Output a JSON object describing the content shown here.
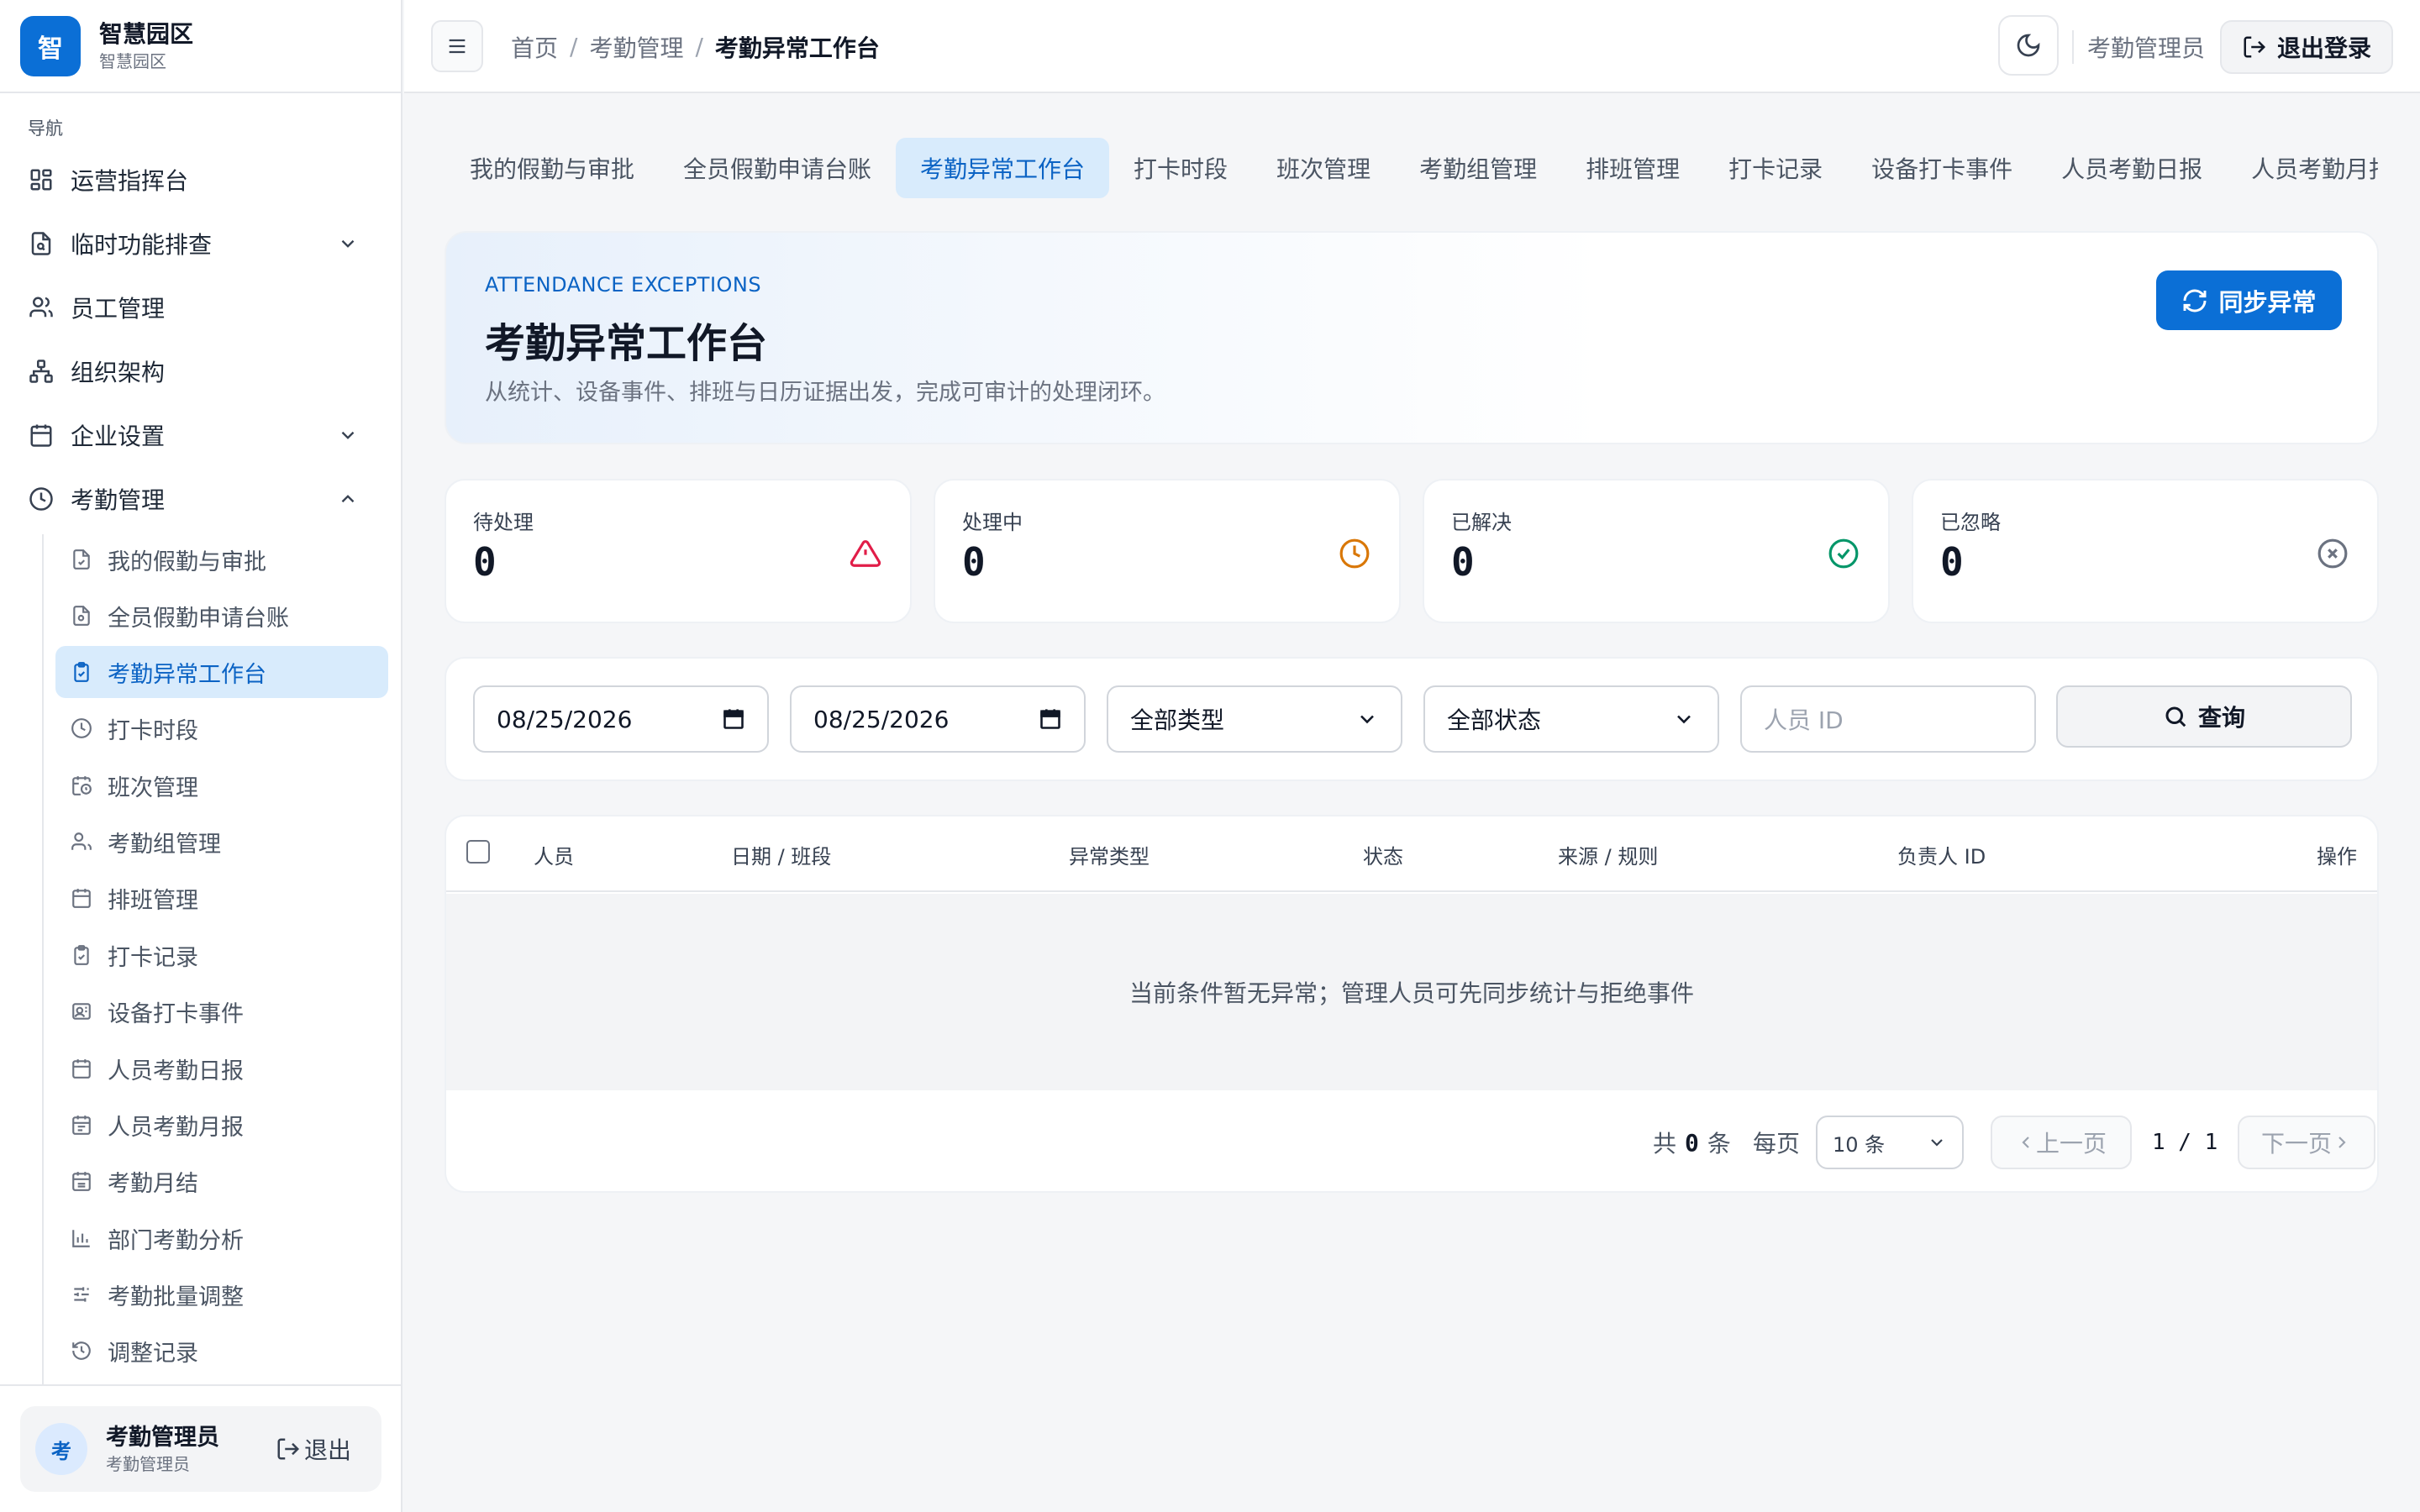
{
  "brand": {
    "logo_char": "智",
    "title": "智慧园区",
    "subtitle": "智慧园区"
  },
  "sidebar": {
    "section_label": "导航",
    "items": [
      {
        "label": "运营指挥台"
      },
      {
        "label": "临时功能排查"
      },
      {
        "label": "员工管理"
      },
      {
        "label": "组织架构"
      },
      {
        "label": "企业设置"
      },
      {
        "label": "考勤管理"
      }
    ],
    "sub_items": [
      {
        "label": "我的假勤与审批"
      },
      {
        "label": "全员假勤申请台账"
      },
      {
        "label": "考勤异常工作台"
      },
      {
        "label": "打卡时段"
      },
      {
        "label": "班次管理"
      },
      {
        "label": "考勤组管理"
      },
      {
        "label": "排班管理"
      },
      {
        "label": "打卡记录"
      },
      {
        "label": "设备打卡事件"
      },
      {
        "label": "人员考勤日报"
      },
      {
        "label": "人员考勤月报"
      },
      {
        "label": "考勤月结"
      },
      {
        "label": "部门考勤分析"
      },
      {
        "label": "考勤批量调整"
      },
      {
        "label": "调整记录"
      }
    ],
    "active_sub": "考勤异常工作台",
    "user": {
      "avatar_char": "考",
      "name": "考勤管理员",
      "role": "考勤管理员",
      "logout_label": "退出"
    }
  },
  "header": {
    "breadcrumb": [
      "首页",
      "考勤管理",
      "考勤异常工作台"
    ],
    "breadcrumb_sep": "/",
    "role": "考勤管理员",
    "logout_label": "退出登录"
  },
  "tabs": [
    {
      "label": "我的假勤与审批"
    },
    {
      "label": "全员假勤申请台账"
    },
    {
      "label": "考勤异常工作台"
    },
    {
      "label": "打卡时段"
    },
    {
      "label": "班次管理"
    },
    {
      "label": "考勤组管理"
    },
    {
      "label": "排班管理"
    },
    {
      "label": "打卡记录"
    },
    {
      "label": "设备打卡事件"
    },
    {
      "label": "人员考勤日报"
    },
    {
      "label": "人员考勤月报"
    }
  ],
  "hero": {
    "kicker": "ATTENDANCE EXCEPTIONS",
    "title": "考勤异常工作台",
    "description": "从统计、设备事件、排班与日历证据出发，完成可审计的处理闭环。",
    "sync_label": "同步异常"
  },
  "stats": [
    {
      "label": "待处理",
      "value": "0",
      "icon": "alert-triangle-icon",
      "color": "#e11d48"
    },
    {
      "label": "处理中",
      "value": "0",
      "icon": "clock-icon",
      "color": "#d97706"
    },
    {
      "label": "已解决",
      "value": "0",
      "icon": "check-circle-icon",
      "color": "#059669"
    },
    {
      "label": "已忽略",
      "value": "0",
      "icon": "x-circle-icon",
      "color": "#6b7280"
    }
  ],
  "filters": {
    "start_date": "08/25/2026",
    "end_date": "08/25/2026",
    "type_select": "全部类型",
    "status_select": "全部状态",
    "person_id_placeholder": "人员 ID",
    "query_label": "查询"
  },
  "table": {
    "columns": [
      "人员",
      "日期 / 班段",
      "异常类型",
      "状态",
      "来源 / 规则",
      "负责人 ID",
      "操作"
    ],
    "empty_text": "当前条件暂无异常；管理人员可先同步统计与拒绝事件"
  },
  "pagination": {
    "total_prefix": "共",
    "total": "0",
    "total_suffix": "条",
    "per_page_label": "每页",
    "page_size": "10 条",
    "prev_label": "上一页",
    "next_label": "下一页",
    "page_info": "1 / 1"
  },
  "colors": {
    "accent": "#0b6fd6",
    "active_bg": "#d8ebfc",
    "active_text": "#0b63c4"
  }
}
